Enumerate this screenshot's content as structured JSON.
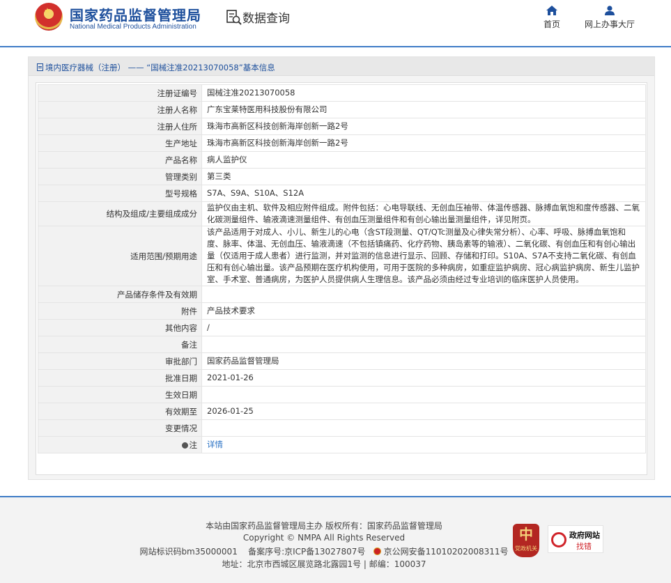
{
  "header": {
    "brand_cn": "国家药品监督管理局",
    "brand_en": "National Medical Products Administration",
    "query_label": "数据查询",
    "nav": [
      {
        "label": "首页",
        "icon": "home-icon"
      },
      {
        "label": "网上办事大厅",
        "icon": "user-icon"
      }
    ]
  },
  "breadcrumb": "境内医疗器械（注册） —— “国械注准20213070058”基本信息",
  "details": {
    "rows": [
      {
        "label": "注册证编号",
        "value": "国械注准20213070058"
      },
      {
        "label": "注册人名称",
        "value": "广东宝莱特医用科技股份有限公司"
      },
      {
        "label": "注册人住所",
        "value": "珠海市高新区科技创新海岸创新一路2号"
      },
      {
        "label": "生产地址",
        "value": "珠海市高新区科技创新海岸创新一路2号"
      },
      {
        "label": "产品名称",
        "value": "病人监护仪"
      },
      {
        "label": "管理类别",
        "value": "第三类"
      },
      {
        "label": "型号规格",
        "value": "S7A、S9A、S10A、S12A"
      },
      {
        "label": "结构及组成/主要组成成分",
        "value": "监护仪由主机、软件及相应附件组成。附件包括：心电导联线、无创血压袖带、体温传感器、脉搏血氧饱和度传感器、二氧化碳测量组件、输液滴速测量组件、有创血压测量组件和有创心输出量测量组件，详见附页。"
      },
      {
        "label": "适用范围/预期用途",
        "value": "该产品适用于对成人、小儿、新生儿的心电（含ST段测量、QT/QTc测量及心律失常分析）、心率、呼吸、脉搏血氧饱和度、脉率、体温、无创血压、输液滴速（不包括镇痛药、化疗药物、胰岛素等的输液）、二氧化碳、有创血压和有创心输出量（仅适用于成人患者）进行监测，并对监测的信息进行显示、回顾、存储和打印。S10A、S7A不支持二氧化碳、有创血压和有创心输出量。该产品预期在医疗机构使用，可用于医院的多种病房，如重症监护病房、冠心病监护病房、新生儿监护室、手术室、普通病房，为医护人员提供病人生理信息。该产品必须由经过专业培训的临床医护人员使用。"
      },
      {
        "label": "产品储存条件及有效期",
        "value": ""
      },
      {
        "label": "附件",
        "value": "产品技术要求"
      },
      {
        "label": "其他内容",
        "value": "/"
      },
      {
        "label": "备注",
        "value": ""
      },
      {
        "label": "审批部门",
        "value": "国家药品监督管理局"
      },
      {
        "label": "批准日期",
        "value": "2021-01-26"
      },
      {
        "label": "生效日期",
        "value": ""
      },
      {
        "label": "有效期至",
        "value": "2026-01-25"
      },
      {
        "label": "变更情况",
        "value": ""
      }
    ],
    "note_label": "注",
    "note_link": "详情"
  },
  "footer": {
    "line1": "本站由国家药品监督管理局主办 版权所有：国家药品监督管理局",
    "line2": "Copyright © NMPA All Rights Reserved",
    "site_id": "网站标识码bm35000001",
    "icp": "备案序号:京ICP备13027807号",
    "police": "京公网安备11010202008311号",
    "line4": "地址：北京市西城区展览路北露园1号 | 邮编：100037",
    "badge_jc": "党政机关",
    "badge_jc_glyph": "中",
    "badge_zf_title": "政府网站",
    "badge_zf_action": "找错"
  },
  "colors": {
    "brand_blue": "#1d4f9c",
    "link": "#2a72c4",
    "accent_line": "#3d7bc6"
  }
}
